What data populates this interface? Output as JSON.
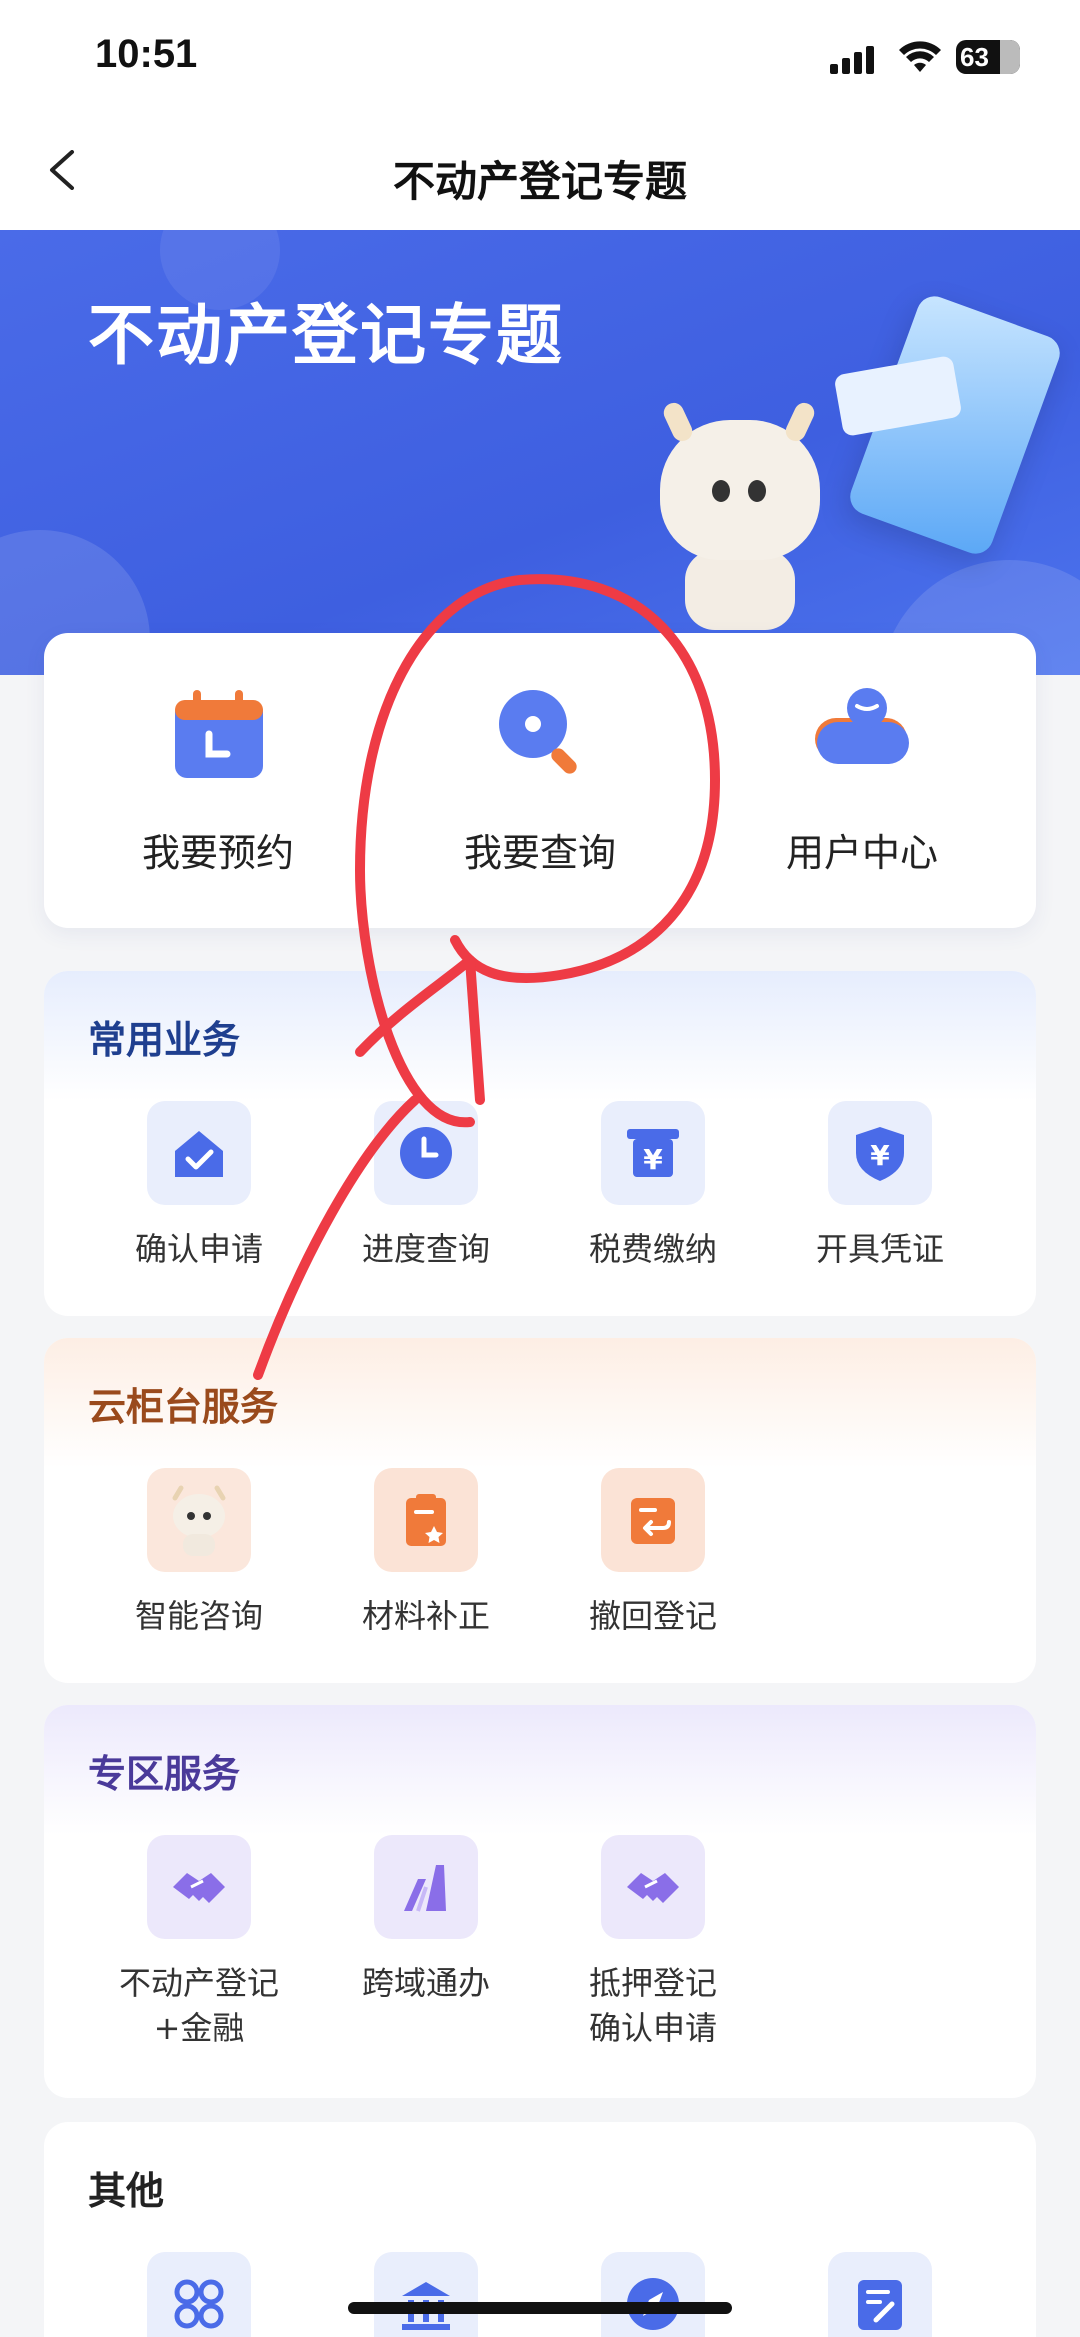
{
  "status_bar": {
    "time": "10:51",
    "battery": "63"
  },
  "nav": {
    "title": "不动产登记专题"
  },
  "banner": {
    "title": "不动产登记专题"
  },
  "quick_actions": [
    {
      "label": "我要预约",
      "icon": "calendar-icon"
    },
    {
      "label": "我要查询",
      "icon": "search-icon"
    },
    {
      "label": "用户中心",
      "icon": "user-toggle-icon"
    }
  ],
  "sections": {
    "common": {
      "title": "常用业务",
      "title_color": "#1f3f8f",
      "items": [
        {
          "label": "确认申请",
          "icon": "house-check-icon"
        },
        {
          "label": "进度查询",
          "icon": "clock-icon"
        },
        {
          "label": "税费缴纳",
          "icon": "yen-box-icon"
        },
        {
          "label": "开具凭证",
          "icon": "yen-shield-icon"
        }
      ]
    },
    "cloud": {
      "title": "云柜台服务",
      "title_color": "#9a4a1c",
      "items": [
        {
          "label": "智能咨询",
          "icon": "mascot-icon"
        },
        {
          "label": "材料补正",
          "icon": "clipboard-star-icon"
        },
        {
          "label": "撤回登记",
          "icon": "undo-doc-icon"
        }
      ]
    },
    "zone": {
      "title": "专区服务",
      "title_color": "#4a3a9a",
      "items": [
        {
          "label": "不动产登记\n+金融",
          "line1": "不动产登记",
          "line2": "+金融",
          "icon": "handshake-icon"
        },
        {
          "label": "跨域通办",
          "icon": "route-icon"
        },
        {
          "label": "抵押登记\n确认申请",
          "line1": "抵押登记",
          "line2": "确认申请",
          "icon": "handshake-icon"
        }
      ]
    },
    "other": {
      "title": "其他",
      "items": [
        {
          "icon": "apps-icon"
        },
        {
          "icon": "bank-icon"
        },
        {
          "icon": "compass-icon"
        },
        {
          "icon": "edit-doc-icon"
        }
      ]
    }
  },
  "colors": {
    "accent": "#4a6be8",
    "annotation": "#ee3b45"
  }
}
